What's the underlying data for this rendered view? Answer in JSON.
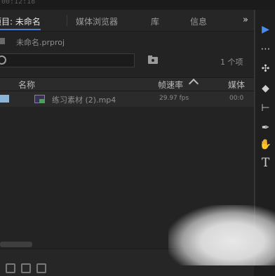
{
  "top": {
    "timecode": "00:12:18"
  },
  "tabs": [
    {
      "label": "项目: 未命名",
      "active": true
    },
    {
      "label": "媒体浏览器",
      "active": false
    },
    {
      "label": "库",
      "active": false
    },
    {
      "label": "信息",
      "active": false
    }
  ],
  "overflow_label": "»",
  "project": {
    "name": "未命名.prproj"
  },
  "search": {
    "value": ""
  },
  "item_count": "1 个项",
  "columns": {
    "name": "名称",
    "framerate": "帧速率",
    "media": "媒体"
  },
  "rows": [
    {
      "name": "练习素材 (2).mp4",
      "framerate": "29.97 fps",
      "media_start": "00:0"
    }
  ],
  "tools": [
    {
      "name": "selection-tool-icon",
      "glyph": "▶"
    },
    {
      "name": "track-select-tool-icon",
      "glyph": "⋯"
    },
    {
      "name": "ripple-edit-tool-icon",
      "glyph": "✣"
    },
    {
      "name": "razor-tool-icon",
      "glyph": "◆"
    },
    {
      "name": "slip-tool-icon",
      "glyph": "⊢"
    },
    {
      "name": "pen-tool-icon",
      "glyph": "✒"
    },
    {
      "name": "hand-tool-icon",
      "glyph": "✋"
    },
    {
      "name": "type-tool-icon",
      "glyph": "T"
    }
  ],
  "colors": {
    "accent": "#4a7dd6",
    "label_chip": "#8ab4d8",
    "clip_icon": "#8b77c9"
  }
}
